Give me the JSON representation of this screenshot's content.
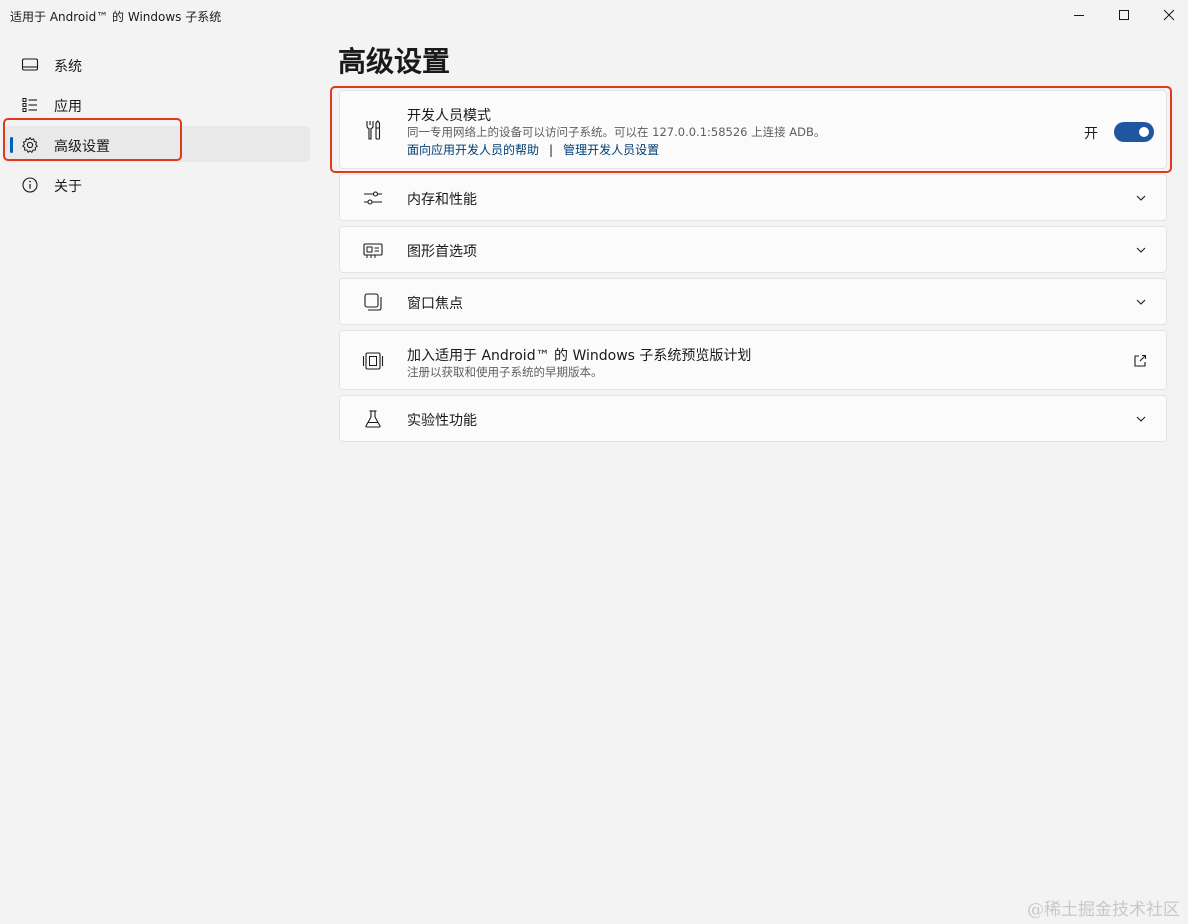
{
  "window": {
    "title": "适用于 Android™ 的 Windows 子系统"
  },
  "nav": {
    "items": [
      {
        "label": "系统",
        "icon": "monitor-icon"
      },
      {
        "label": "应用",
        "icon": "app-list-icon"
      },
      {
        "label": "高级设置",
        "icon": "gear-icon",
        "selected": true
      },
      {
        "label": "关于",
        "icon": "info-icon"
      }
    ]
  },
  "page": {
    "title": "高级设置"
  },
  "developer": {
    "title": "开发人员模式",
    "description": "同一专用网络上的设备可以访问子系统。可以在 127.0.0.1:58526 上连接 ADB。",
    "link1": "面向应用开发人员的帮助",
    "separator": "|",
    "link2": "管理开发人员设置",
    "toggle_label": "开",
    "toggle_on": true
  },
  "cards": {
    "memory": {
      "title": "内存和性能"
    },
    "graphics": {
      "title": "图形首选项"
    },
    "focus": {
      "title": "窗口焦点"
    },
    "preview": {
      "title": "加入适用于 Android™ 的 Windows 子系统预览版计划",
      "description": "注册以获取和使用子系统的早期版本。"
    },
    "experimental": {
      "title": "实验性功能"
    }
  },
  "watermark": "@稀土掘金技术社区",
  "colors": {
    "accent": "#005fb8",
    "toggle": "#1e56a0",
    "highlight": "#e03a1e"
  }
}
